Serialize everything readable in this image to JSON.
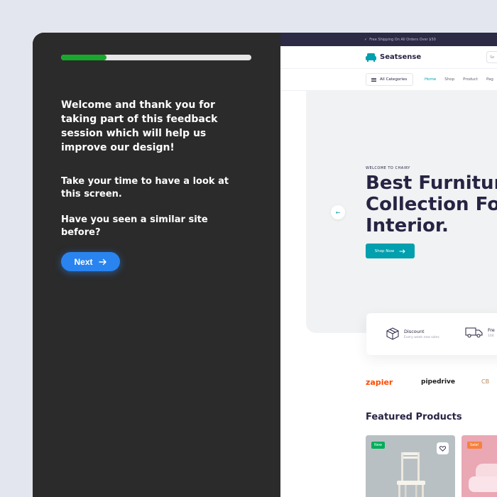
{
  "survey": {
    "progress_percent": 24,
    "intro": "Welcome and thank you for taking part of this feedback session which will help us improve our design!",
    "look": "Take your time to have a look at this screen.",
    "question": "Have you seen a similar site before?",
    "next_label": "Next"
  },
  "site": {
    "topbar_text": "Free Shipping On All Orders Over $50",
    "brand": "Seatsense",
    "search_placeholder": "Se",
    "categories_label": "All Categories",
    "nav": [
      "Home",
      "Shop",
      "Product",
      "Pag"
    ],
    "hero": {
      "kicker": "WELCOME TO CHAIRY",
      "title_lines": [
        "Best Furniture",
        "Collection For",
        "Interior."
      ],
      "button_label": "Shop Now"
    },
    "features": [
      {
        "title": "Discount",
        "subtitle": "Every week new sales"
      },
      {
        "title": "Fre",
        "subtitle": "100"
      }
    ],
    "brands": [
      "zapier",
      "pipedrive",
      "CB"
    ],
    "featured_title": "Featured Products",
    "products": [
      {
        "badge": "New"
      },
      {
        "badge": "Sale!"
      }
    ]
  },
  "colors": {
    "panel_bg": "#2b2b2b",
    "progress_fill": "#18a82c",
    "next_button": "#2a84ef",
    "site_accent": "#029fae",
    "site_dark": "#272343",
    "topbar_bg": "#2c2a45"
  },
  "icons": [
    "arrow-right-icon",
    "check-icon",
    "sofa-logo-icon",
    "box-icon",
    "truck-icon",
    "heart-icon",
    "arrow-left-icon"
  ]
}
